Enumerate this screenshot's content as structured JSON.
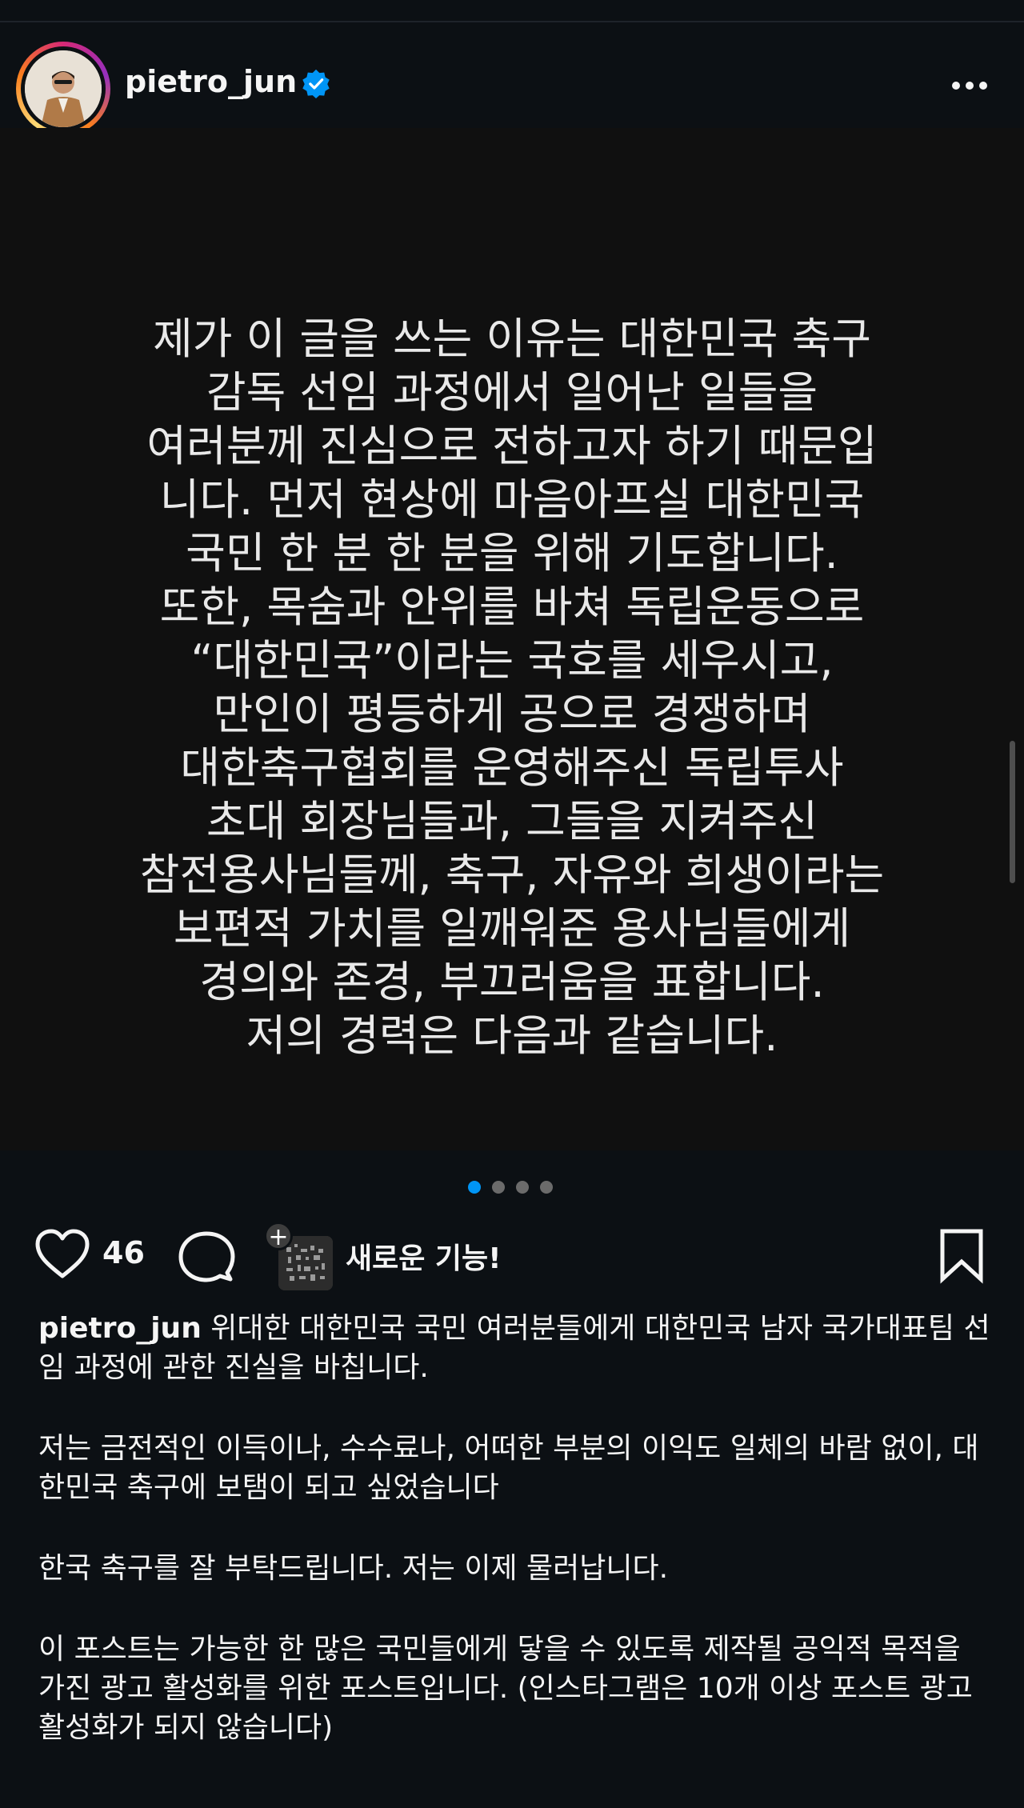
{
  "post": {
    "username": "pietro_jun",
    "verified": true,
    "image_text": "제가 이 글을 쓰는 이유는 대한민국 축구\n감독 선임 과정에서 일어난 일들을\n여러분께 진심으로 전하고자 하기 때문입\n니다. 먼저 현상에 마음아프실 대한민국\n국민 한 분 한 분을 위해 기도합니다.\n또한, 목숨과 안위를 바쳐 독립운동으로\n“대한민국”이라는 국호를 세우시고,\n만인이 평등하게 공으로 경쟁하며\n대한축구협회를 운영해주신 독립투사\n초대 회장님들과, 그들을 지켜주신\n참전용사님들께, 축구, 자유와 희생이라는\n보편적 가치를 일깨워준 용사님들에게\n경의와 존경, 부끄러움을 표합니다.\n저의 경력은 다음과 같습니다.",
    "carousel": {
      "count": 4,
      "active_index": 0
    }
  },
  "actions": {
    "like_count": "46",
    "new_feature_label": "새로운 기능!"
  },
  "caption": {
    "username": "pietro_jun",
    "first_text": " 위대한 대한민국 국민 여러분들에게 대한민국 남자 국가대표팀 선임 과정에 관한 진실을 바칩니다.",
    "paragraphs": [
      "저는 금전적인 이득이나, 수수료나, 어떠한 부분의 이익도 일체의 바람 없이, 대한민국 축구에 보탬이 되고 싶었습니다",
      "한국 축구를 잘 부탁드립니다. 저는 이제 물러납니다.",
      "이 포스트는 가능한 한 많은 국민들에게 닿을 수 있도록 제작될 공익적 목적을 가진 광고 활성화를 위한 포스트입니다. (인스타그램은 10개 이상 포스트 광고 활성화가 되지 않습니다)"
    ]
  },
  "colors": {
    "background": "#0c1014",
    "verified_blue": "#0095f6",
    "active_dot": "#0095f6",
    "inactive_dot": "#6b6b6b"
  },
  "icons": [
    "verified-badge-icon",
    "more-options-icon",
    "heart-icon",
    "comment-icon",
    "plus-icon",
    "bookmark-icon"
  ]
}
